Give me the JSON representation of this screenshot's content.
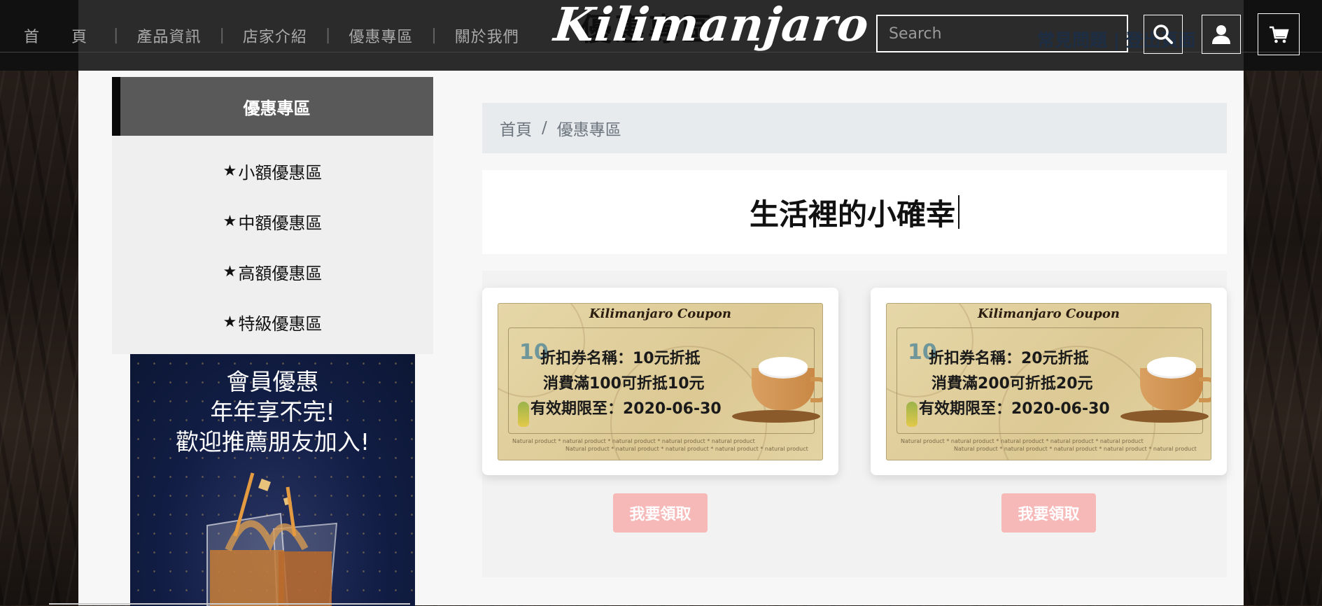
{
  "nav": {
    "items": [
      "首　頁",
      "產品資訊",
      "店家介紹",
      "優惠專區",
      "關於我們"
    ],
    "separator": "|"
  },
  "header": {
    "ghost_title": "優惠專區",
    "logo": "Kilimanjaro",
    "search_placeholder": "Search",
    "ghost_links": "常見問題 | 登出頁面",
    "icons": [
      "search-icon",
      "user-icon",
      "cart-icon"
    ]
  },
  "sidebar": {
    "title": "優惠專區",
    "items": [
      "小額優惠區",
      "中額優惠區",
      "高額優惠區",
      "特級優惠區"
    ],
    "star": "★"
  },
  "promo": {
    "lines": [
      "會員優惠",
      "年年享不完!",
      "歡迎推薦朋友加入!"
    ]
  },
  "breadcrumb": {
    "home": "首頁",
    "separator": "/",
    "current": "優惠專區"
  },
  "main": {
    "title": "生活裡的小確幸"
  },
  "coupons": [
    {
      "header": "Kilimanjaro  Coupon",
      "badge": "10",
      "name": "折扣券名稱：10元折抵",
      "condition": "消費滿100可折抵10元",
      "expiry": "有效期限至：2020-06-30",
      "fine": "Natural product * natural product * natural product * natural product * natural product",
      "button": "我要領取"
    },
    {
      "header": "Kilimanjaro  Coupon",
      "badge": "10",
      "name": "折扣券名稱：20元折抵",
      "condition": "消費滿200可折抵20元",
      "expiry": "有效期限至：2020-06-30",
      "fine": "Natural product * natural product * natural product * natural product * natural product",
      "button": "我要領取"
    }
  ],
  "colors": {
    "topbar": "#2b2b2b",
    "sidebar_header": "#595959",
    "claim_button": "#f7b8b8",
    "breadcrumb_bg": "#e8ebee"
  }
}
